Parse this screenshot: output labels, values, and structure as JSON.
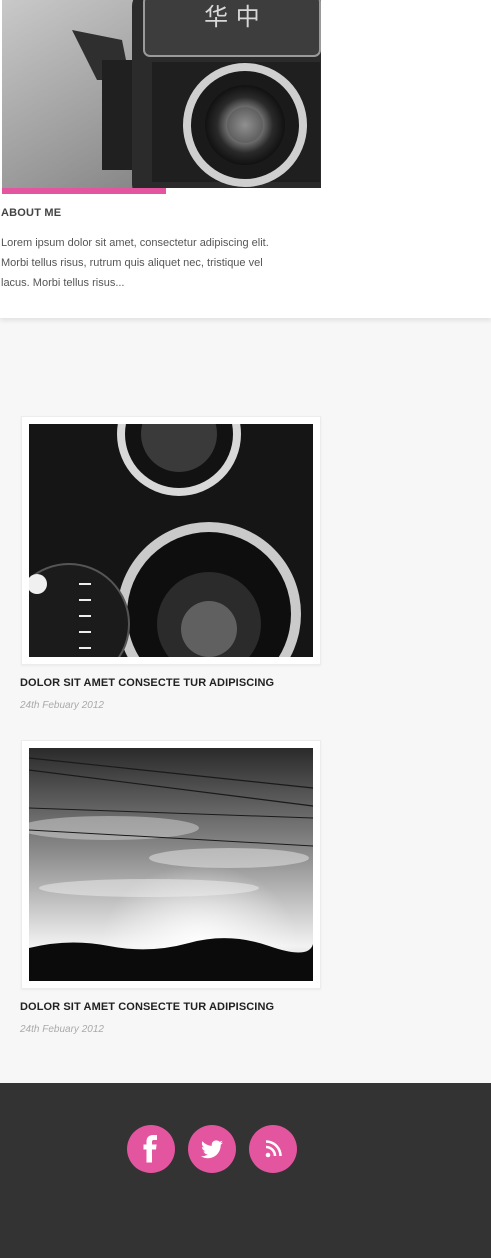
{
  "about": {
    "title": "ABOUT ME",
    "text": "Lorem ipsum dolor sit amet, consectetur adipiscing elit. Morbi tellus risus, rutrum quis aliquet nec, tristique vel lacus.  Morbi tellus risus..."
  },
  "hero": {
    "camera_label": "华 中"
  },
  "posts": [
    {
      "title": "DOLOR SIT AMET CONSECTE TUR ADIPISCING",
      "date": "24th Febuary 2012"
    },
    {
      "title": "DOLOR SIT AMET CONSECTE TUR ADIPISCING",
      "date": "24th Febuary 2012"
    }
  ],
  "social": {
    "facebook": "facebook-icon",
    "twitter": "twitter-icon",
    "rss": "rss-icon"
  },
  "colors": {
    "accent": "#e4559f",
    "footer": "#333333",
    "background": "#f7f7f7"
  }
}
